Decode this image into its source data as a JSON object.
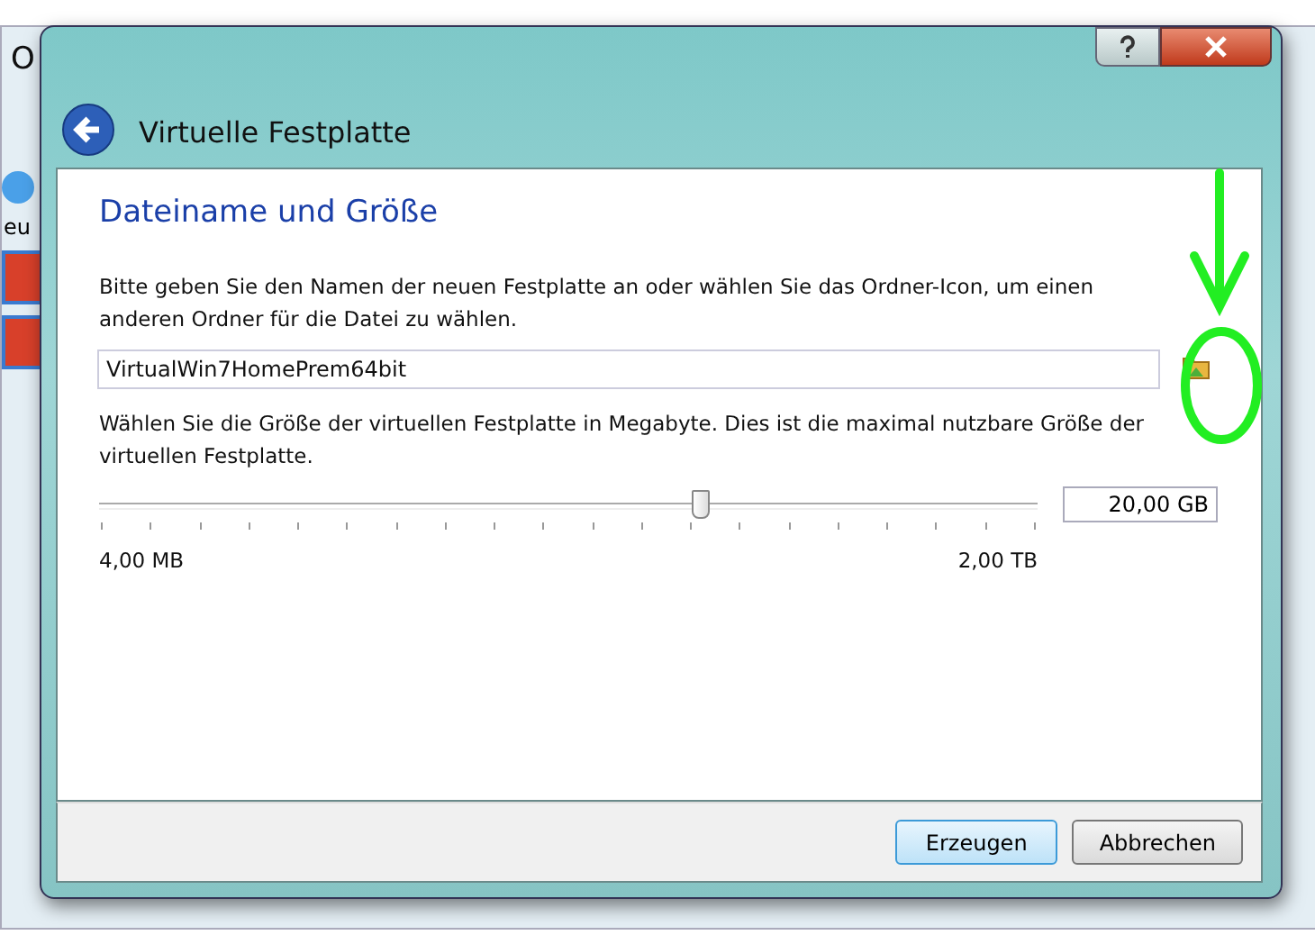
{
  "background_window": {
    "title": "O",
    "sidebar_label": "eu"
  },
  "dialog": {
    "title": "Virtuelle Festplatte"
  },
  "page": {
    "heading": "Dateiname und Größe",
    "name_hint": "Bitte geben Sie den Namen der neuen Festplatte an oder wählen Sie das Ordner-Icon, um einen anderen Ordner für die Datei zu wählen.",
    "file_name": "VirtualWin7HomePrem64bit",
    "size_hint": "Wählen Sie die Größe der virtuellen Festplatte in Megabyte. Dies ist die maximal nutzbare Größe der virtuellen Festplatte.",
    "size_slider": {
      "level": 0.64,
      "min_label": "4,00 MB",
      "max_label": "2,00 TB"
    },
    "size_value": "20,00 GB"
  },
  "buttons": [
    {
      "label": "Erzeugen",
      "default": true
    },
    {
      "label": "Abbrechen",
      "default": false
    }
  ]
}
